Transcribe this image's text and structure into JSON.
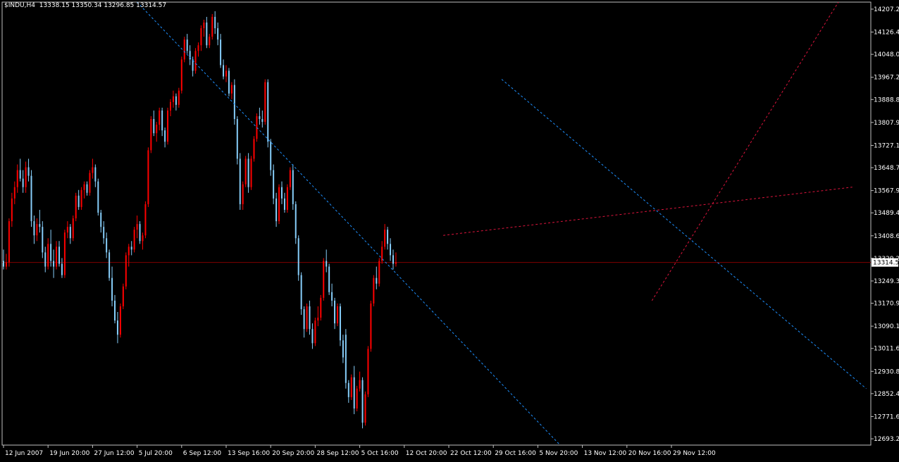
{
  "header": {
    "symbol": "$INDU,H4",
    "ohlc": "13338.15 13350.34 13296.85 13314.57"
  },
  "colors": {
    "background": "#000000",
    "frame": "#c0c0c0",
    "text": "#ffffff",
    "bull": "#ff0000",
    "bear": "#87cefa",
    "channel": "#1e90ff",
    "trend": "#dc143c",
    "bid_line": "#800000",
    "price_tag_bg": "#ffffff",
    "price_tag_text": "#000000"
  },
  "chart_data": {
    "type": "candlestick",
    "timeframe": "H4",
    "symbol": "$INDU",
    "y_ticks": [
      14207.25,
      14126.45,
      14048.05,
      13967.2,
      13888.8,
      13807.95,
      13727.1,
      13648.7,
      13567.9,
      13489.45,
      13408.6,
      13329.2,
      13249.35,
      13170.95,
      13090.1,
      13011.65,
      12930.85,
      12852.45,
      12771.6,
      12693.2
    ],
    "y_tick_labels": [
      "14207.25",
      "14126.45",
      "14048.05",
      "13967.20",
      "13888.80",
      "13807.95",
      "13727.10",
      "13648.70",
      "13567.90",
      "13489.45",
      "13408.60",
      "13329.20",
      "13249.35",
      "13170.95",
      "13090.10",
      "13011.65",
      "12930.85",
      "12852.45",
      "12771.60",
      "12693.20"
    ],
    "ylim": [
      12671.0,
      14232.0
    ],
    "x_labels": [
      "12 Jun 2007",
      "19 Jun 20:00",
      "27 Jun 12:00",
      "5 Jul 20:00",
      "6 Sep 12:00",
      "13 Sep 16:00",
      "20 Sep 20:00",
      "28 Sep 12:00",
      "5 Oct 16:00",
      "12 Oct 20:00",
      "22 Oct 12:00",
      "29 Oct 16:00",
      "5 Nov 20:00",
      "13 Nov 12:00",
      "20 Nov 16:00",
      "29 Nov 12:00"
    ],
    "x_label_bars": [
      0,
      16,
      32,
      48,
      64,
      80,
      96,
      112,
      128,
      144,
      160,
      176,
      192,
      208,
      224,
      240
    ],
    "current_price": 13314.57,
    "current_price_label": "13314.57",
    "candles": [
      [
        13320,
        13360,
        13290,
        13300
      ],
      [
        13300,
        13345,
        13290,
        13315
      ],
      [
        13315,
        13470,
        13300,
        13460
      ],
      [
        13460,
        13560,
        13440,
        13540
      ],
      [
        13540,
        13600,
        13520,
        13580
      ],
      [
        13580,
        13660,
        13560,
        13640
      ],
      [
        13640,
        13680,
        13600,
        13610
      ],
      [
        13610,
        13640,
        13560,
        13580
      ],
      [
        13580,
        13670,
        13560,
        13650
      ],
      [
        13650,
        13680,
        13600,
        13620
      ],
      [
        13620,
        13640,
        13440,
        13460
      ],
      [
        13460,
        13480,
        13380,
        13410
      ],
      [
        13410,
        13470,
        13390,
        13450
      ],
      [
        13450,
        13500,
        13420,
        13440
      ],
      [
        13440,
        13460,
        13330,
        13350
      ],
      [
        13350,
        13370,
        13280,
        13300
      ],
      [
        13300,
        13400,
        13290,
        13380
      ],
      [
        13380,
        13430,
        13300,
        13320
      ],
      [
        13320,
        13360,
        13260,
        13300
      ],
      [
        13300,
        13390,
        13290,
        13370
      ],
      [
        13370,
        13390,
        13300,
        13310
      ],
      [
        13310,
        13330,
        13260,
        13270
      ],
      [
        13270,
        13430,
        13260,
        13420
      ],
      [
        13420,
        13460,
        13400,
        13440
      ],
      [
        13440,
        13450,
        13380,
        13400
      ],
      [
        13400,
        13480,
        13390,
        13470
      ],
      [
        13470,
        13560,
        13460,
        13550
      ],
      [
        13550,
        13570,
        13500,
        13510
      ],
      [
        13510,
        13580,
        13500,
        13570
      ],
      [
        13570,
        13600,
        13540,
        13590
      ],
      [
        13590,
        13600,
        13550,
        13560
      ],
      [
        13560,
        13640,
        13550,
        13630
      ],
      [
        13630,
        13680,
        13610,
        13650
      ],
      [
        13650,
        13660,
        13580,
        13600
      ],
      [
        13600,
        13610,
        13480,
        13490
      ],
      [
        13490,
        13500,
        13420,
        13440
      ],
      [
        13440,
        13460,
        13380,
        13400
      ],
      [
        13400,
        13420,
        13330,
        13350
      ],
      [
        13350,
        13360,
        13250,
        13260
      ],
      [
        13260,
        13300,
        13160,
        13180
      ],
      [
        13180,
        13200,
        13100,
        13110
      ],
      [
        13110,
        13140,
        13030,
        13060
      ],
      [
        13060,
        13170,
        13050,
        13160
      ],
      [
        13160,
        13240,
        13150,
        13230
      ],
      [
        13230,
        13350,
        13220,
        13340
      ],
      [
        13340,
        13380,
        13300,
        13370
      ],
      [
        13370,
        13390,
        13340,
        13360
      ],
      [
        13360,
        13440,
        13350,
        13430
      ],
      [
        13430,
        13480,
        13400,
        13450
      ],
      [
        13450,
        13460,
        13380,
        13390
      ],
      [
        13390,
        13420,
        13360,
        13410
      ],
      [
        13410,
        13530,
        13400,
        13520
      ],
      [
        13520,
        13720,
        13510,
        13710
      ],
      [
        13710,
        13830,
        13700,
        13820
      ],
      [
        13820,
        13850,
        13760,
        13770
      ],
      [
        13770,
        13810,
        13740,
        13800
      ],
      [
        13800,
        13860,
        13780,
        13850
      ],
      [
        13850,
        13860,
        13760,
        13780
      ],
      [
        13780,
        13790,
        13720,
        13740
      ],
      [
        13740,
        13860,
        13730,
        13850
      ],
      [
        13850,
        13890,
        13830,
        13880
      ],
      [
        13880,
        13920,
        13860,
        13900
      ],
      [
        13900,
        13910,
        13850,
        13870
      ],
      [
        13870,
        13930,
        13860,
        13920
      ],
      [
        13920,
        14040,
        13910,
        14030
      ],
      [
        14030,
        14110,
        14020,
        14100
      ],
      [
        14100,
        14120,
        14050,
        14060
      ],
      [
        14060,
        14080,
        14010,
        14030
      ],
      [
        14030,
        14040,
        13970,
        13990
      ],
      [
        13990,
        14070,
        13980,
        14060
      ],
      [
        14060,
        14090,
        14040,
        14080
      ],
      [
        14080,
        14150,
        14060,
        14140
      ],
      [
        14140,
        14170,
        14110,
        14160
      ],
      [
        14160,
        14180,
        14070,
        14080
      ],
      [
        14080,
        14120,
        14070,
        14110
      ],
      [
        14110,
        14190,
        14100,
        14180
      ],
      [
        14180,
        14200,
        14120,
        14140
      ],
      [
        14140,
        14160,
        14080,
        14100
      ],
      [
        14100,
        14120,
        14000,
        14010
      ],
      [
        14010,
        14030,
        13960,
        13970
      ],
      [
        13970,
        14010,
        13950,
        13990
      ],
      [
        13990,
        14000,
        13900,
        13910
      ],
      [
        13910,
        13950,
        13890,
        13940
      ],
      [
        13940,
        13960,
        13800,
        13820
      ],
      [
        13820,
        13830,
        13660,
        13680
      ],
      [
        13680,
        13700,
        13500,
        13520
      ],
      [
        13520,
        13600,
        13500,
        13590
      ],
      [
        13590,
        13690,
        13580,
        13680
      ],
      [
        13680,
        13700,
        13560,
        13580
      ],
      [
        13580,
        13690,
        13570,
        13680
      ],
      [
        13680,
        13760,
        13670,
        13750
      ],
      [
        13750,
        13840,
        13740,
        13830
      ],
      [
        13830,
        13860,
        13800,
        13820
      ],
      [
        13820,
        13850,
        13790,
        13810
      ],
      [
        13810,
        13960,
        13800,
        13950
      ],
      [
        13950,
        13960,
        13720,
        13740
      ],
      [
        13740,
        13750,
        13620,
        13640
      ],
      [
        13640,
        13660,
        13520,
        13540
      ],
      [
        13540,
        13560,
        13440,
        13460
      ],
      [
        13460,
        13590,
        13450,
        13580
      ],
      [
        13580,
        13600,
        13520,
        13540
      ],
      [
        13540,
        13560,
        13490,
        13500
      ],
      [
        13500,
        13590,
        13490,
        13580
      ],
      [
        13580,
        13650,
        13570,
        13640
      ],
      [
        13640,
        13660,
        13500,
        13520
      ],
      [
        13520,
        13530,
        13380,
        13400
      ],
      [
        13400,
        13410,
        13250,
        13270
      ],
      [
        13270,
        13280,
        13130,
        13150
      ],
      [
        13150,
        13160,
        13050,
        13080
      ],
      [
        13080,
        13170,
        13070,
        13160
      ],
      [
        13160,
        13180,
        13060,
        13080
      ],
      [
        13080,
        13100,
        13010,
        13030
      ],
      [
        13030,
        13120,
        13020,
        13110
      ],
      [
        13110,
        13160,
        13090,
        13120
      ],
      [
        13120,
        13200,
        13110,
        13190
      ],
      [
        13190,
        13330,
        13180,
        13320
      ],
      [
        13320,
        13360,
        13280,
        13300
      ],
      [
        13300,
        13310,
        13200,
        13210
      ],
      [
        13210,
        13240,
        13160,
        13180
      ],
      [
        13180,
        13190,
        13080,
        13100
      ],
      [
        13100,
        13170,
        13090,
        13160
      ],
      [
        13160,
        13170,
        13020,
        13040
      ],
      [
        13040,
        13060,
        12960,
        12980
      ],
      [
        13060,
        13080,
        12870,
        12890
      ],
      [
        12890,
        12900,
        12820,
        12840
      ],
      [
        12840,
        12920,
        12830,
        12910
      ],
      [
        12910,
        12950,
        12780,
        12800
      ],
      [
        12800,
        12880,
        12790,
        12870
      ],
      [
        12870,
        12930,
        12860,
        12900
      ],
      [
        12900,
        12910,
        12730,
        12750
      ],
      [
        12750,
        12860,
        12740,
        12850
      ],
      [
        12850,
        13020,
        12840,
        13010
      ],
      [
        13010,
        13180,
        13000,
        13170
      ],
      [
        13170,
        13270,
        13160,
        13260
      ],
      [
        13260,
        13300,
        13220,
        13240
      ],
      [
        13240,
        13330,
        13230,
        13320
      ],
      [
        13320,
        13390,
        13310,
        13370
      ],
      [
        13370,
        13450,
        13360,
        13430
      ],
      [
        13430,
        13440,
        13360,
        13380
      ],
      [
        13380,
        13400,
        13320,
        13340
      ],
      [
        13340,
        13360,
        13290,
        13310
      ],
      [
        13310,
        13350,
        13300,
        13315
      ]
    ],
    "channel_lines": [
      {
        "from": {
          "bar": 48,
          "price": 14232
        },
        "to": {
          "bar": 200,
          "price": 12671
        }
      },
      {
        "from": {
          "bar": 179,
          "price": 13960
        },
        "to": {
          "bar": 310,
          "price": 12870
        }
      }
    ],
    "trend_lines": [
      {
        "from": {
          "bar": 158,
          "price": 13410
        },
        "to": {
          "bar": 305,
          "price": 13580
        }
      },
      {
        "from": {
          "bar": 233,
          "price": 13180
        },
        "to": {
          "bar": 300,
          "price": 14232
        }
      }
    ]
  }
}
